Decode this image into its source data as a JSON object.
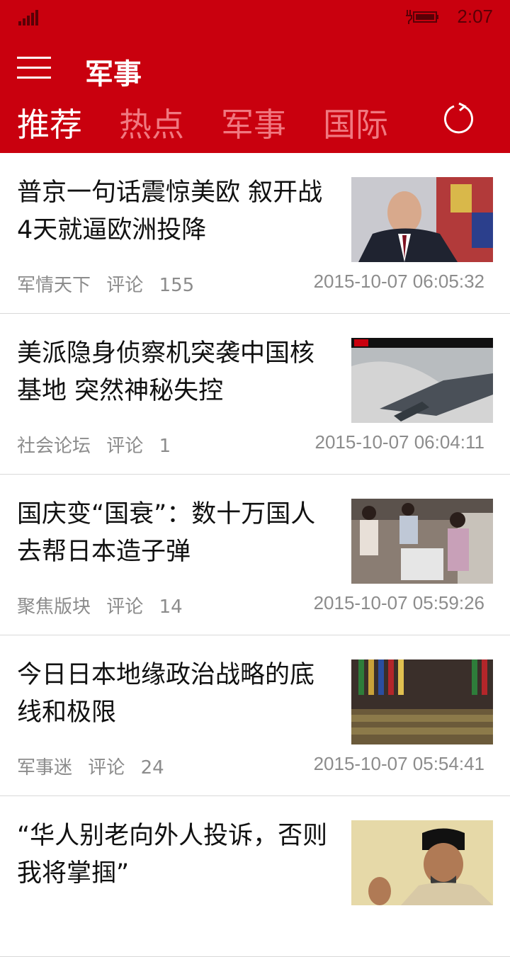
{
  "status": {
    "time": "2:07"
  },
  "header": {
    "title": "军事"
  },
  "tabs": [
    {
      "label": "推荐",
      "active": true
    },
    {
      "label": "热点",
      "active": false
    },
    {
      "label": "军事",
      "active": false
    },
    {
      "label": "国际",
      "active": false
    }
  ],
  "icons": {
    "menu": "hamburger-menu-icon",
    "refresh": "refresh-icon",
    "signal": "signal-strength-icon",
    "battery": "battery-charging-icon"
  },
  "colors": {
    "brand": "#c9000e",
    "inactive_tab": "#f07880",
    "meta_text": "#8c8c8c"
  },
  "articles": [
    {
      "title": "普京一句话震惊美欧 叙开战4天就逼欧洲投降",
      "source": "军情天下",
      "comment_label": "评论",
      "comments": "155",
      "time": "2015-10-07 06:05:32"
    },
    {
      "title": "美派隐身侦察机突袭中国核基地 突然神秘失控",
      "source": "社会论坛",
      "comment_label": "评论",
      "comments": "1",
      "time": "2015-10-07 06:04:11"
    },
    {
      "title": "国庆变“国衰”：数十万国人去帮日本造子弹",
      "source": "聚焦版块",
      "comment_label": "评论",
      "comments": "14",
      "time": "2015-10-07 05:59:26"
    },
    {
      "title": "今日日本地缘政治战略的底线和极限",
      "source": "军事迷",
      "comment_label": "评论",
      "comments": "24",
      "time": "2015-10-07 05:54:41"
    },
    {
      "title": "“华人别老向外人投诉，否则我将掌掴”",
      "source": "",
      "comment_label": "",
      "comments": "",
      "time": ""
    }
  ]
}
